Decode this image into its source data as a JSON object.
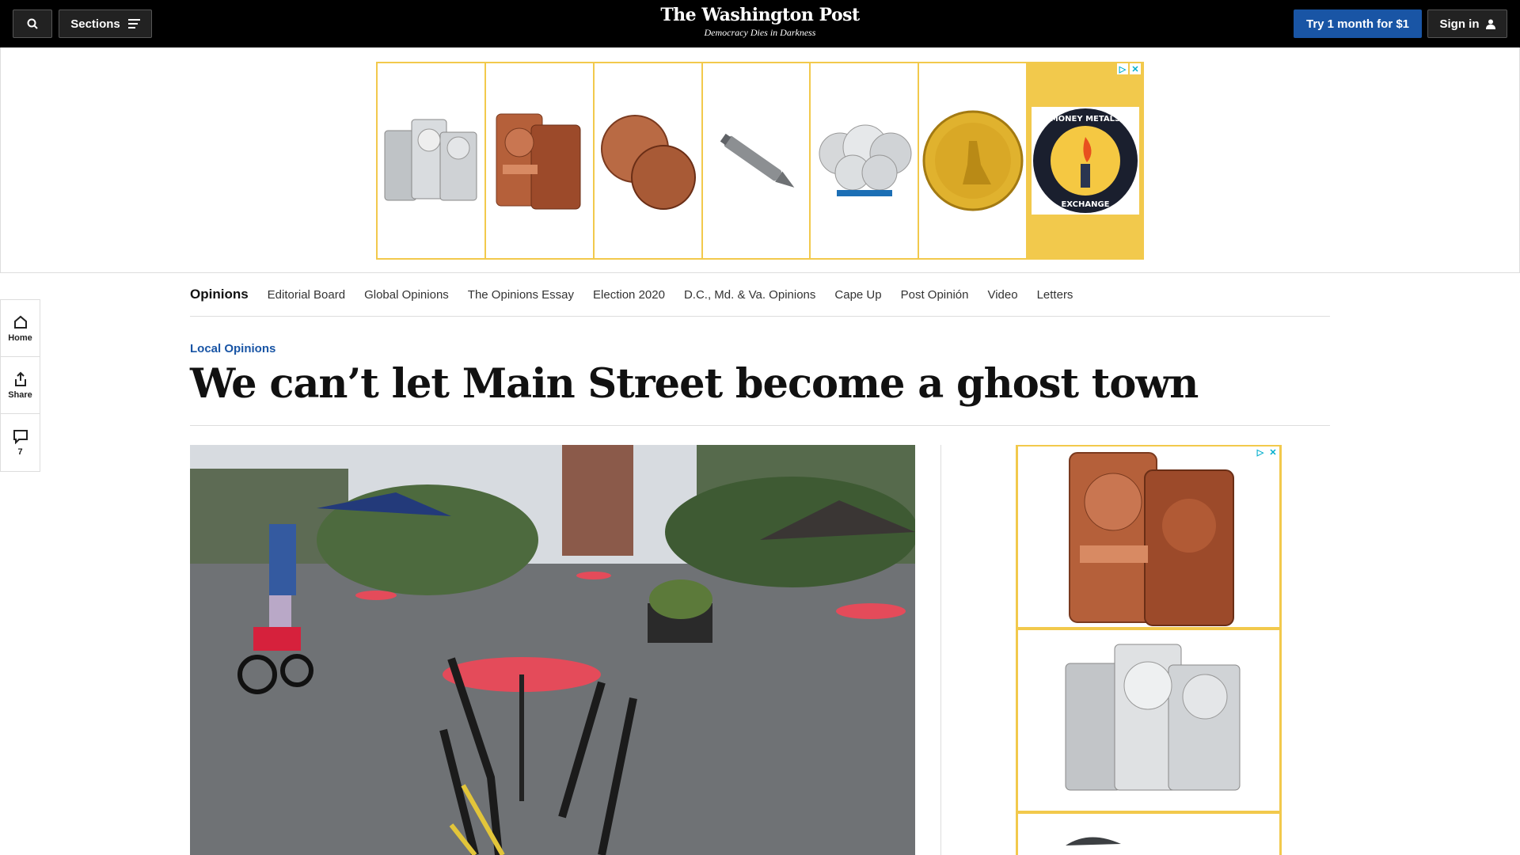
{
  "header": {
    "sections_label": "Sections",
    "logo_name": "The Washington Post",
    "logo_tagline": "Democracy Dies in Darkness",
    "try_label": "Try 1 month for $1",
    "signin_label": "Sign in"
  },
  "siderail": {
    "home_label": "Home",
    "share_label": "Share",
    "comments_count": "7"
  },
  "opinions_nav": {
    "items": [
      "Opinions",
      "Editorial Board",
      "Global Opinions",
      "The Opinions Essay",
      "Election 2020",
      "D.C., Md. & Va. Opinions",
      "Cape Up",
      "Post Opinión",
      "Video",
      "Letters"
    ]
  },
  "article": {
    "kicker": "Local Opinions",
    "headline": "We can’t let Main Street become a ghost town"
  },
  "ads": {
    "top_logo_text": "MONEY METALS EXCHANGE",
    "accent": "#f2c94c"
  },
  "colors": {
    "brand_blue": "#1955a5",
    "topbar": "#000000"
  }
}
